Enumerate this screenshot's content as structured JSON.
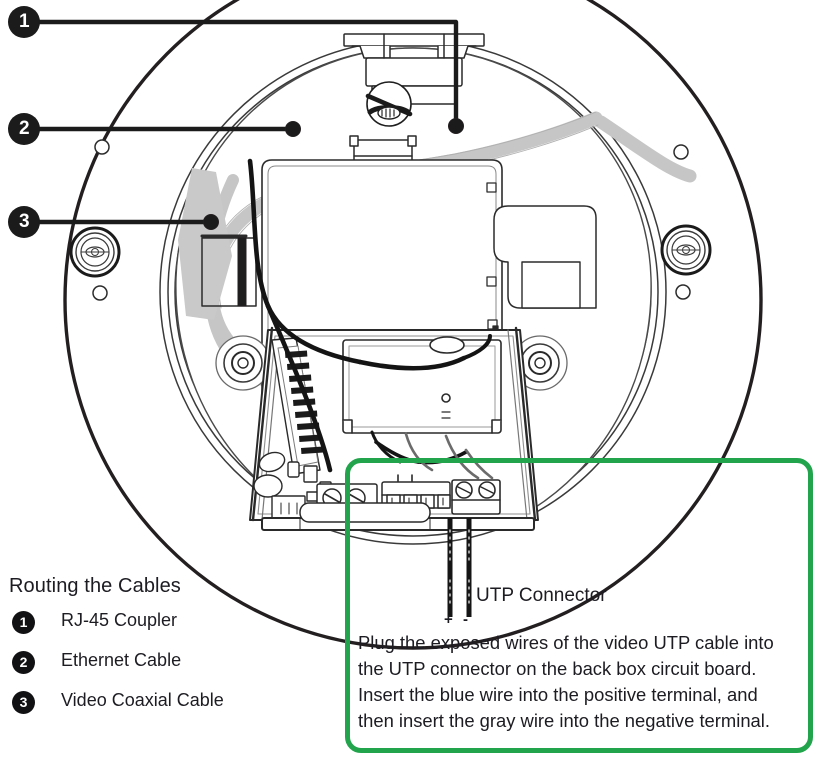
{
  "figure": {
    "title": "Routing the Cables",
    "description": "Exploded view of a dome camera back box showing cable routing, with three numbered callouts and a highlighted UTP connector detail."
  },
  "callouts": [
    {
      "number": "1",
      "label": "RJ-45 Coupler"
    },
    {
      "number": "2",
      "label": "Ethernet Cable"
    },
    {
      "number": "3",
      "label": "Video Coaxial Cable"
    }
  ],
  "detail": {
    "connector_label": "UTP Connector",
    "terminal_positive": "+",
    "terminal_negative": "-",
    "instruction_lines": [
      "Plug the exposed wires of the video UTP cable into",
      "the UTP connector on the back box circuit board.",
      "Insert the blue wire into the positive terminal, and",
      "then insert the gray wire into the negative terminal."
    ]
  },
  "colors": {
    "highlight_green": "#22a44c",
    "ink": "#1c1c22",
    "badge_fill": "#111114",
    "badge_text": "#ffffff",
    "cable_gray": "#c8c8c8",
    "line_black": "#231f20"
  }
}
